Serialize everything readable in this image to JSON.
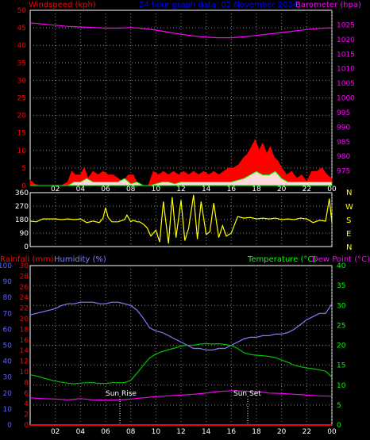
{
  "header": {
    "wind_label": "Windspeed (kph)",
    "title": "24 hour graph data: 02 November 2024",
    "baro_label": "Barometer (hpa)"
  },
  "colors": {
    "wind": "#ff0000",
    "baro": "#ff00ff",
    "dir": "#ffff00",
    "hum": "#8080ff",
    "temp": "#00c000",
    "temp_axis": "#00ff00",
    "dew": "#ff00ff",
    "rain": "#ff0000",
    "gust": "#ff0000",
    "avg": "#00ff00",
    "title": "#0000ff",
    "hum_axis": "#6060ff"
  },
  "bottom_header": {
    "rain_label": "Rainfall (mm)",
    "hum_label": "Humidity (%)",
    "temp_label": "Temperature (°C)",
    "dew_label": "Dew Point (°C)"
  },
  "x_ticks": [
    "02",
    "04",
    "06",
    "08",
    "10",
    "12",
    "14",
    "16",
    "18",
    "20",
    "22",
    "00"
  ],
  "compass": [
    "N",
    "W",
    "S",
    "E",
    "N"
  ],
  "annotations": {
    "sunrise": "Sun Rise",
    "sunset": "Sun Set"
  },
  "chart_data": [
    {
      "type": "line",
      "title": "24 hour graph data: 02 November 2024",
      "ylabel": "Windspeed (kph)",
      "y2label": "Barometer (hpa)",
      "ylim": [
        0,
        50
      ],
      "y2lim": [
        970,
        1030
      ],
      "xlim": [
        0,
        24
      ],
      "yticks": [
        0,
        5,
        10,
        15,
        20,
        25,
        30,
        35,
        40,
        45,
        50
      ],
      "y2ticks": [
        975,
        980,
        985,
        990,
        995,
        1000,
        1005,
        1010,
        1015,
        1020,
        1025
      ],
      "grid": true,
      "series": [
        {
          "name": "Barometer (hpa)",
          "axis": "right",
          "x": [
            0,
            1,
            2,
            3,
            4,
            5,
            6,
            7,
            8,
            9,
            10,
            11,
            12,
            13,
            14,
            15,
            16,
            17,
            18,
            19,
            20,
            21,
            22,
            23,
            24
          ],
          "y": [
            1025.7,
            1025.3,
            1024.9,
            1024.5,
            1024.3,
            1024.1,
            1023.9,
            1023.9,
            1024.1,
            1023.8,
            1023.2,
            1022.5,
            1021.8,
            1021.2,
            1020.8,
            1020.6,
            1020.6,
            1020.9,
            1021.4,
            1021.9,
            1022.4,
            1022.9,
            1023.4,
            1023.8,
            1024.0
          ]
        },
        {
          "name": "Windspeed (kph)",
          "axis": "left",
          "role": "gust",
          "x": [
            0,
            0.3,
            0.6,
            1,
            1.5,
            2,
            2.5,
            3,
            3.3,
            3.6,
            4,
            4.3,
            4.6,
            5,
            5.4,
            5.8,
            6.2,
            6.6,
            7,
            7.4,
            7.8,
            8.2,
            8.6,
            9,
            9.4,
            9.8,
            10.2,
            10.6,
            11,
            11.4,
            11.8,
            12.2,
            12.6,
            13,
            13.4,
            13.8,
            14.2,
            14.6,
            15,
            15.4,
            15.8,
            16.2,
            16.6,
            17,
            17.3,
            17.6,
            17.9,
            18.2,
            18.5,
            18.8,
            19.1,
            19.4,
            19.7,
            20,
            20.4,
            20.8,
            21.2,
            21.6,
            22,
            22.4,
            22.8,
            23.2,
            23.6,
            24
          ],
          "y": [
            1.5,
            0.5,
            0,
            0,
            0,
            0,
            0,
            1,
            4,
            3,
            3,
            5,
            2,
            4,
            3,
            4,
            3,
            3,
            2,
            1,
            3,
            3,
            0,
            0,
            0,
            4,
            3,
            4,
            3,
            4,
            3,
            4,
            3,
            4,
            3,
            4,
            3,
            4,
            3,
            4,
            5,
            5,
            6,
            8,
            9,
            11,
            13,
            10,
            12,
            9,
            11,
            8,
            7,
            5,
            3,
            4,
            2,
            3,
            1,
            4,
            4,
            5,
            3,
            2
          ]
        },
        {
          "name": "Average wind",
          "axis": "left",
          "role": "average",
          "x": [
            0,
            1,
            2,
            3,
            3.5,
            4,
            4.5,
            5,
            5.5,
            6,
            6.5,
            7,
            7.5,
            8,
            8.5,
            9,
            9.5,
            10,
            10.5,
            11,
            11.5,
            12,
            12.5,
            13,
            13.5,
            14,
            14.5,
            15,
            15.5,
            16,
            16.5,
            17,
            17.5,
            18,
            18.5,
            19,
            19.5,
            20,
            20.5,
            21,
            21.5,
            22,
            22.5,
            23,
            23.5,
            24
          ],
          "y": [
            0,
            0,
            0,
            0,
            1,
            1,
            2,
            1,
            1,
            1,
            1,
            1,
            2,
            0.5,
            1,
            0,
            0,
            0.5,
            1,
            1,
            0.5,
            1,
            1,
            1,
            1,
            1,
            1,
            1,
            1,
            1,
            1.5,
            2,
            3,
            4,
            3,
            3,
            4,
            2,
            1,
            1,
            1,
            1,
            1,
            1,
            1,
            1
          ]
        }
      ]
    },
    {
      "type": "line",
      "title": "",
      "ylabel": "",
      "ylim": [
        0,
        360
      ],
      "xlim": [
        0,
        24
      ],
      "yticks": [
        0,
        90,
        180,
        270,
        360
      ],
      "series": [
        {
          "name": "Wind direction",
          "x": [
            0,
            0.5,
            1,
            1.5,
            2,
            2.5,
            3,
            3.5,
            4,
            4.5,
            5,
            5.5,
            5.8,
            6,
            6.2,
            6.5,
            7,
            7.5,
            7.7,
            8,
            8.2,
            8.5,
            8.7,
            9,
            9.3,
            9.6,
            10,
            10.3,
            10.6,
            11,
            11.3,
            11.6,
            12,
            12.3,
            12.6,
            13,
            13.3,
            13.6,
            14,
            14.3,
            14.6,
            15,
            15.3,
            15.6,
            16,
            16.5,
            17,
            17.5,
            18,
            18.5,
            19,
            19.5,
            20,
            20.5,
            21,
            21.5,
            22,
            22.5,
            23,
            23.5,
            23.8,
            24
          ],
          "y": [
            170,
            165,
            185,
            185,
            185,
            180,
            185,
            180,
            185,
            160,
            170,
            160,
            190,
            260,
            195,
            165,
            165,
            180,
            210,
            165,
            175,
            165,
            165,
            150,
            125,
            70,
            110,
            30,
            300,
            20,
            330,
            60,
            310,
            40,
            120,
            345,
            50,
            300,
            80,
            100,
            290,
            60,
            140,
            70,
            90,
            200,
            190,
            195,
            185,
            190,
            185,
            190,
            180,
            185,
            180,
            190,
            185,
            160,
            175,
            170,
            320,
            160
          ]
        }
      ]
    },
    {
      "type": "line",
      "title": "",
      "ylabel": "Rainfall (mm)",
      "y2label": "Humidity (%)",
      "y3label": "Temperature (°C)",
      "y4label": "Dew Point (°C)",
      "rain_ticks": [
        0,
        2,
        4,
        6,
        8,
        10,
        12,
        14,
        16,
        18,
        20,
        22,
        24,
        26,
        28,
        30
      ],
      "hum_ticks": [
        0,
        10,
        20,
        30,
        40,
        50,
        60,
        70,
        80,
        90,
        100
      ],
      "temp_ticks": [
        0,
        5,
        10,
        15,
        20,
        25,
        30,
        35,
        40
      ],
      "xlim": [
        0,
        24
      ],
      "grid": true,
      "series": [
        {
          "name": "Humidity (%)",
          "axis": "humidity",
          "ylim": [
            0,
            100
          ],
          "x": [
            0,
            0.5,
            1,
            1.5,
            2,
            2.5,
            3,
            3.5,
            4,
            4.5,
            5,
            5.5,
            6,
            6.5,
            7,
            7.5,
            8,
            8.5,
            9,
            9.5,
            10,
            10.5,
            11,
            11.5,
            12,
            12.5,
            13,
            13.5,
            14,
            14.5,
            15,
            15.5,
            16,
            16.5,
            17,
            17.5,
            18,
            18.5,
            19,
            19.5,
            20,
            20.5,
            21,
            21.5,
            22,
            22.5,
            23,
            23.5,
            24
          ],
          "y": [
            69,
            70,
            71,
            72,
            73,
            75,
            76,
            76,
            77,
            77,
            77,
            76,
            76,
            77,
            77,
            76,
            75,
            72,
            67,
            61,
            59,
            58,
            56,
            54,
            52,
            50,
            48,
            48,
            47,
            47,
            48,
            48,
            50,
            52,
            54,
            55,
            55,
            56,
            56,
            57,
            57,
            58,
            60,
            63,
            66,
            68,
            70,
            70,
            76
          ]
        },
        {
          "name": "Temperature (°C)",
          "axis": "temperature",
          "ylim": [
            0,
            40
          ],
          "x": [
            0,
            0.5,
            1,
            1.5,
            2,
            2.5,
            3,
            3.5,
            4,
            4.5,
            5,
            5.5,
            6,
            6.5,
            7,
            7.5,
            8,
            8.5,
            9,
            9.5,
            10,
            10.5,
            11,
            11.5,
            12,
            12.5,
            13,
            13.5,
            14,
            14.5,
            15,
            15.5,
            16,
            16.5,
            17,
            17.5,
            18,
            18.5,
            19,
            19.5,
            20,
            20.5,
            21,
            21.5,
            22,
            22.5,
            23,
            23.5,
            24
          ],
          "y": [
            12.6,
            12.3,
            11.8,
            11.4,
            11.0,
            10.7,
            10.5,
            10.3,
            10.5,
            10.6,
            10.6,
            10.4,
            10.4,
            10.6,
            10.6,
            10.6,
            11.2,
            13.0,
            15.0,
            16.8,
            17.8,
            18.4,
            18.9,
            19.3,
            19.8,
            20.0,
            20.0,
            20.3,
            20.4,
            20.3,
            20.4,
            20.2,
            19.9,
            19.2,
            18.1,
            17.7,
            17.5,
            17.4,
            17.2,
            16.9,
            16.3,
            15.7,
            15.0,
            14.6,
            14.3,
            14.1,
            13.8,
            13.5,
            12.0
          ]
        },
        {
          "name": "Dew Point (°C)",
          "axis": "temperature",
          "ylim": [
            0,
            40
          ],
          "x": [
            0,
            1,
            2,
            3,
            4,
            5,
            6,
            7,
            8,
            9,
            10,
            11,
            12,
            13,
            14,
            15,
            16,
            17,
            18,
            19,
            20,
            21,
            22,
            23,
            24
          ],
          "y": [
            6.8,
            6.6,
            6.5,
            6.3,
            6.6,
            6.3,
            6.2,
            6.3,
            6.5,
            6.8,
            7.1,
            7.3,
            7.5,
            7.7,
            8.0,
            8.4,
            8.6,
            8.5,
            8.4,
            8.0,
            7.9,
            7.7,
            7.5,
            7.3,
            7.2
          ]
        },
        {
          "name": "Rainfall (mm)",
          "axis": "rain",
          "ylim": [
            0,
            30
          ],
          "x": [
            0,
            24
          ],
          "y": [
            0,
            0
          ]
        }
      ]
    }
  ]
}
